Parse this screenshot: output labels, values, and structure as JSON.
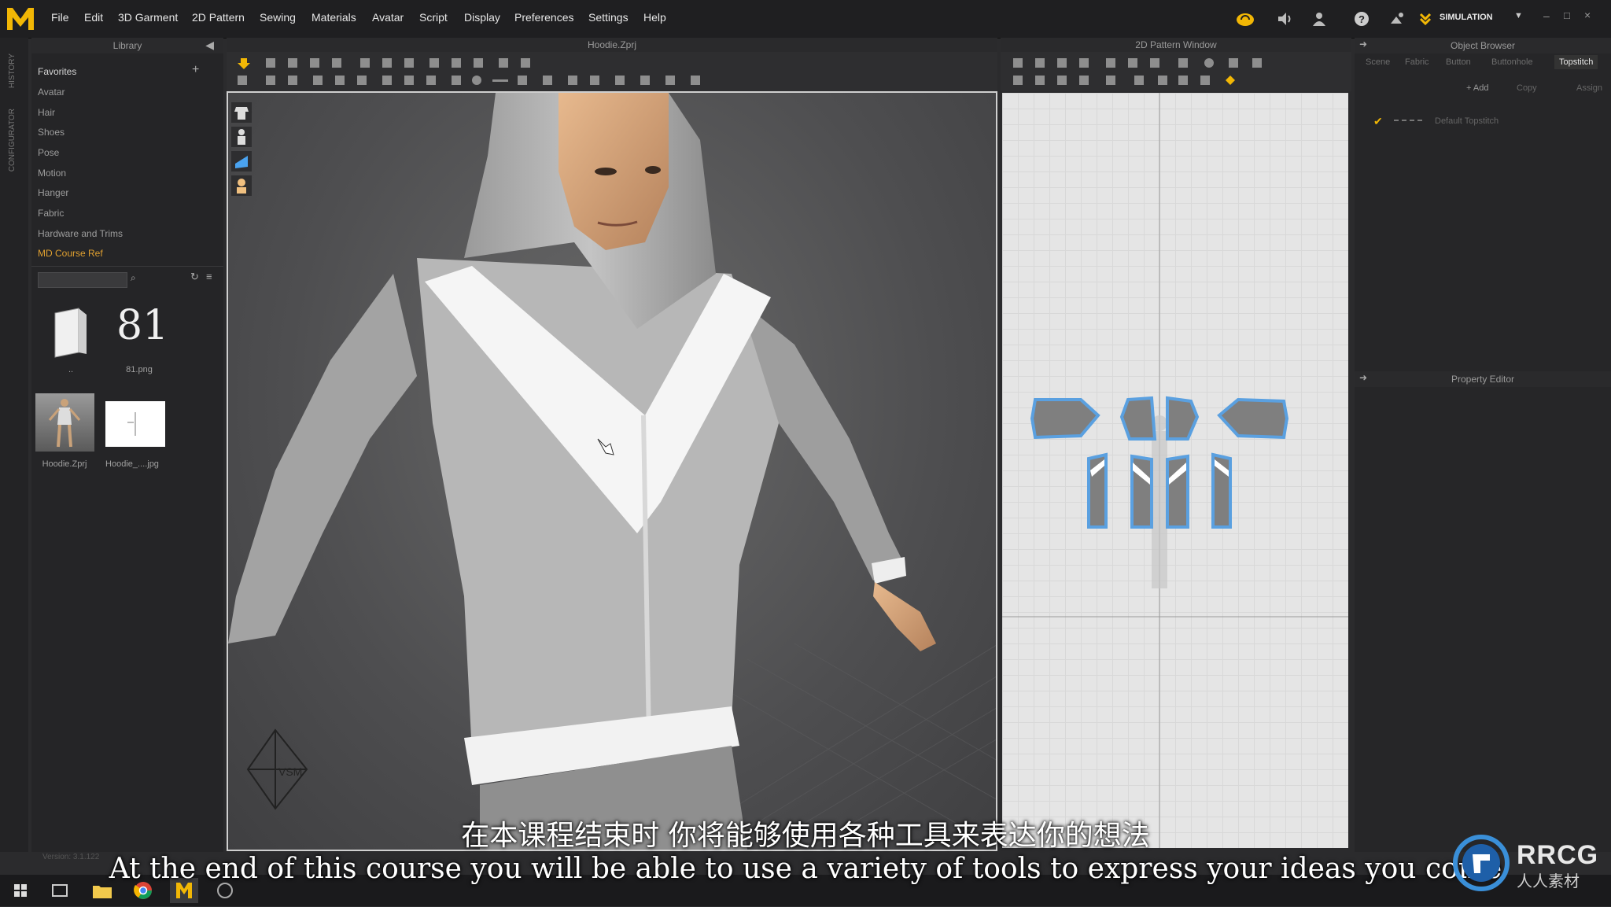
{
  "menubar": {
    "logo": "M",
    "items": [
      "File",
      "Edit",
      "3D Garment",
      "2D Pattern",
      "Sewing",
      "Materials",
      "Avatar",
      "Script",
      "Display",
      "Preferences",
      "Settings",
      "Help"
    ],
    "mode": "SIMULATION"
  },
  "left_rail": {
    "labels": [
      "HISTORY",
      "CONFIGURATOR"
    ]
  },
  "library": {
    "title": "Library",
    "items": [
      "Favorites",
      "Avatar",
      "Hair",
      "Shoes",
      "Pose",
      "Motion",
      "Hanger",
      "Fabric",
      "Hardware and Trims",
      "MD Course Ref"
    ],
    "thumbs": [
      {
        "label": ".."
      },
      {
        "label": "81.png",
        "glyph": "81"
      },
      {
        "label": "Hoodie.Zprj"
      },
      {
        "label": "Hoodie_....jpg"
      }
    ],
    "version": "Version: 3.1.122"
  },
  "viewport": {
    "title": "Hoodie.Zprj",
    "vsm_label": "VSM"
  },
  "pattern_window": {
    "title": "2D Pattern Window"
  },
  "object_browser": {
    "title": "Object Browser",
    "tabs": [
      "Scene",
      "Fabric",
      "Button",
      "Buttonhole",
      "Topstitch"
    ],
    "actions": [
      "+ Add",
      "Copy",
      "Assign"
    ],
    "default_item": "Default Topstitch"
  },
  "property_editor": {
    "title": "Property Editor"
  },
  "subtitles": {
    "cn": "在本课程结束时 你将能够使用各种工具来表达你的想法",
    "en": "At the end of this course you will be able to use a variety of tools to express your ideas you come"
  },
  "watermark": {
    "brand": "RRCG",
    "sub": "人人素材"
  },
  "colors": {
    "accent": "#f2b705",
    "pattern_outline": "#5aa0e0",
    "highlight_text": "#e0a030"
  }
}
